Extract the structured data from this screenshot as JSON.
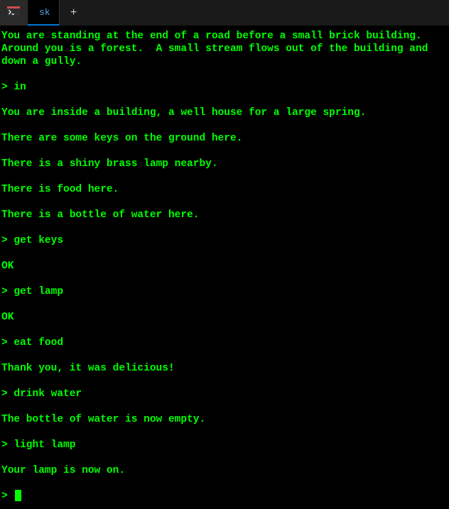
{
  "tabs": {
    "active_label": "sk",
    "new_tab_glyph": "+"
  },
  "terminal": {
    "lines": [
      {
        "type": "text",
        "value": "You are standing at the end of a road before a small brick building.  Around you is a forest.  A small stream flows out of the building and down a gully."
      },
      {
        "type": "blank"
      },
      {
        "type": "prompt",
        "command": "in"
      },
      {
        "type": "blank"
      },
      {
        "type": "text",
        "value": "You are inside a building, a well house for a large spring."
      },
      {
        "type": "blank"
      },
      {
        "type": "text",
        "value": "There are some keys on the ground here."
      },
      {
        "type": "blank"
      },
      {
        "type": "text",
        "value": "There is a shiny brass lamp nearby."
      },
      {
        "type": "blank"
      },
      {
        "type": "text",
        "value": "There is food here."
      },
      {
        "type": "blank"
      },
      {
        "type": "text",
        "value": "There is a bottle of water here."
      },
      {
        "type": "blank"
      },
      {
        "type": "prompt",
        "command": "get keys"
      },
      {
        "type": "blank"
      },
      {
        "type": "text",
        "value": "OK"
      },
      {
        "type": "blank"
      },
      {
        "type": "prompt",
        "command": "get lamp"
      },
      {
        "type": "blank"
      },
      {
        "type": "text",
        "value": "OK"
      },
      {
        "type": "blank"
      },
      {
        "type": "prompt",
        "command": "eat food"
      },
      {
        "type": "blank"
      },
      {
        "type": "text",
        "value": "Thank you, it was delicious!"
      },
      {
        "type": "blank"
      },
      {
        "type": "prompt",
        "command": "drink water"
      },
      {
        "type": "blank"
      },
      {
        "type": "text",
        "value": "The bottle of water is now empty."
      },
      {
        "type": "blank"
      },
      {
        "type": "prompt",
        "command": "light lamp"
      },
      {
        "type": "blank"
      },
      {
        "type": "text",
        "value": "Your lamp is now on."
      },
      {
        "type": "blank"
      },
      {
        "type": "active_prompt"
      }
    ],
    "prompt_symbol": ">"
  },
  "colors": {
    "terminal_text": "#00ff00",
    "terminal_bg": "#000000",
    "tab_active_accent": "#0078d7",
    "tab_active_text": "#5aa0e0"
  }
}
